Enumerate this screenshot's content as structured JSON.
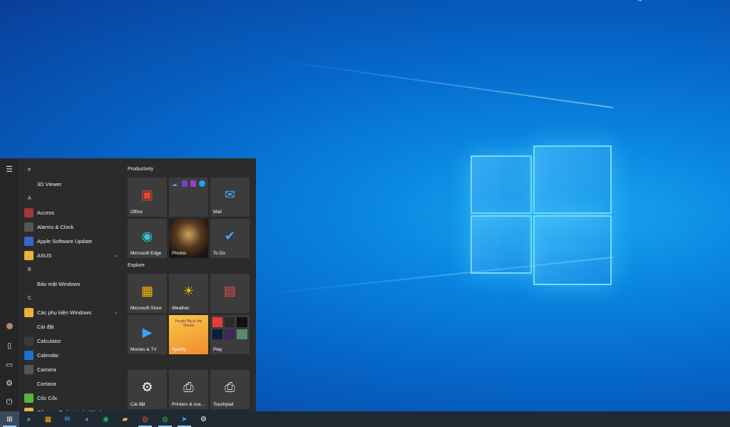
{
  "start_menu": {
    "app_list": [
      {
        "type": "letter",
        "text": "#"
      },
      {
        "type": "app",
        "label": "3D Viewer",
        "icon": "cube-icon",
        "color": "#2b2b2b"
      },
      {
        "type": "letter",
        "text": "A"
      },
      {
        "type": "app",
        "label": "Access",
        "icon": "access-icon",
        "color": "#a4373a"
      },
      {
        "type": "app",
        "label": "Alarms & Clock",
        "icon": "clock-icon",
        "color": "#555"
      },
      {
        "type": "app",
        "label": "Apple Software Update",
        "icon": "apple-update-icon",
        "color": "#3a66c7"
      },
      {
        "type": "folder",
        "label": "ASUS",
        "icon": "folder-icon",
        "color": "#e8b13a"
      },
      {
        "type": "letter",
        "text": "B"
      },
      {
        "type": "app",
        "label": "Bảo mật Windows",
        "icon": "shield-icon",
        "color": "#2b2b2b"
      },
      {
        "type": "letter",
        "text": "C"
      },
      {
        "type": "folder",
        "label": "Các phụ kiện Windows",
        "icon": "folder-icon",
        "color": "#e8b13a"
      },
      {
        "type": "app",
        "label": "Cài đặt",
        "icon": "gear-icon",
        "color": "#2b2b2b"
      },
      {
        "type": "app",
        "label": "Calculator",
        "icon": "calculator-icon",
        "color": "#3a3a3a"
      },
      {
        "type": "app",
        "label": "Calendar",
        "icon": "calendar-icon",
        "color": "#1a73d0"
      },
      {
        "type": "app",
        "label": "Camera",
        "icon": "camera-icon",
        "color": "#555"
      },
      {
        "type": "app",
        "label": "Cortana",
        "icon": "cortana-icon",
        "color": "#2b2b2b"
      },
      {
        "type": "app",
        "label": "Cốc Cốc",
        "icon": "coccoc-icon",
        "color": "#5bb53a"
      },
      {
        "type": "folder",
        "label": "Công cụ Quản trị của Windows",
        "icon": "folder-icon",
        "color": "#e8b13a"
      }
    ],
    "groups": [
      {
        "title": "Productivity"
      },
      {
        "title": "Explore"
      }
    ],
    "tiles": {
      "office": {
        "label": "Office",
        "glyph": "▣",
        "color": "#e8452c"
      },
      "cloud_apps": {
        "label": "",
        "glyph": "☁"
      },
      "mail": {
        "label": "Mail",
        "glyph": "✉",
        "color": "#4aa3ff"
      },
      "edge": {
        "label": "Microsoft Edge",
        "glyph": "◉",
        "color": "#35c0d8"
      },
      "photos": {
        "label": "Photos",
        "glyph": "▦"
      },
      "todo": {
        "label": "To Do",
        "glyph": "✔",
        "color": "#ffffff"
      },
      "store": {
        "label": "Microsoft Store",
        "glyph": "▦",
        "color": "#f4b400"
      },
      "weather": {
        "label": "Weather",
        "glyph": "☀",
        "color": "#f5b400"
      },
      "news": {
        "label": "",
        "glyph": "▤",
        "color": "#e84b4b"
      },
      "movies": {
        "label": "Movies & TV",
        "glyph": "▶",
        "color": "#3aa0ff"
      },
      "spotify": {
        "label": "Spotify",
        "caption": "People Big in the Sheets",
        "glyph": "♪"
      },
      "play": {
        "label": "Play",
        "glyph": "▶"
      },
      "settings": {
        "label": "Cài đặt",
        "glyph": "⚙",
        "color": "#ffffff"
      },
      "printers": {
        "label": "Printers & sca...",
        "glyph": "⎙",
        "color": "#dddddd"
      },
      "touchpad": {
        "label": "Touchpad",
        "glyph": "⎙",
        "color": "#dddddd"
      }
    }
  },
  "taskbar": {
    "items": [
      {
        "name": "start-button",
        "glyph": "⊞",
        "color": "#ffffff",
        "active": true
      },
      {
        "name": "search-button",
        "glyph": "⌕",
        "color": "#ffffff",
        "active": false
      },
      {
        "name": "store-taskbar",
        "glyph": "▦",
        "color": "#f4b400",
        "active": false
      },
      {
        "name": "mail-taskbar",
        "glyph": "✉",
        "color": "#4aa3ff",
        "active": false
      },
      {
        "name": "discord-taskbar",
        "glyph": "◕",
        "color": "#7289da",
        "active": false
      },
      {
        "name": "spotify-taskbar",
        "glyph": "◉",
        "color": "#1db954",
        "active": false
      },
      {
        "name": "file-explorer-taskbar",
        "glyph": "▰",
        "color": "#f0c040",
        "active": false
      },
      {
        "name": "chrome-taskbar",
        "glyph": "◍",
        "color": "#e04b3c",
        "active": true
      },
      {
        "name": "chrome-profile-taskbar",
        "glyph": "◍",
        "color": "#34a853",
        "active": true
      },
      {
        "name": "telegram-taskbar",
        "glyph": "➤",
        "color": "#37aee2",
        "active": true
      },
      {
        "name": "settings-taskbar",
        "glyph": "⚙",
        "color": "#ffffff",
        "active": false
      }
    ]
  }
}
